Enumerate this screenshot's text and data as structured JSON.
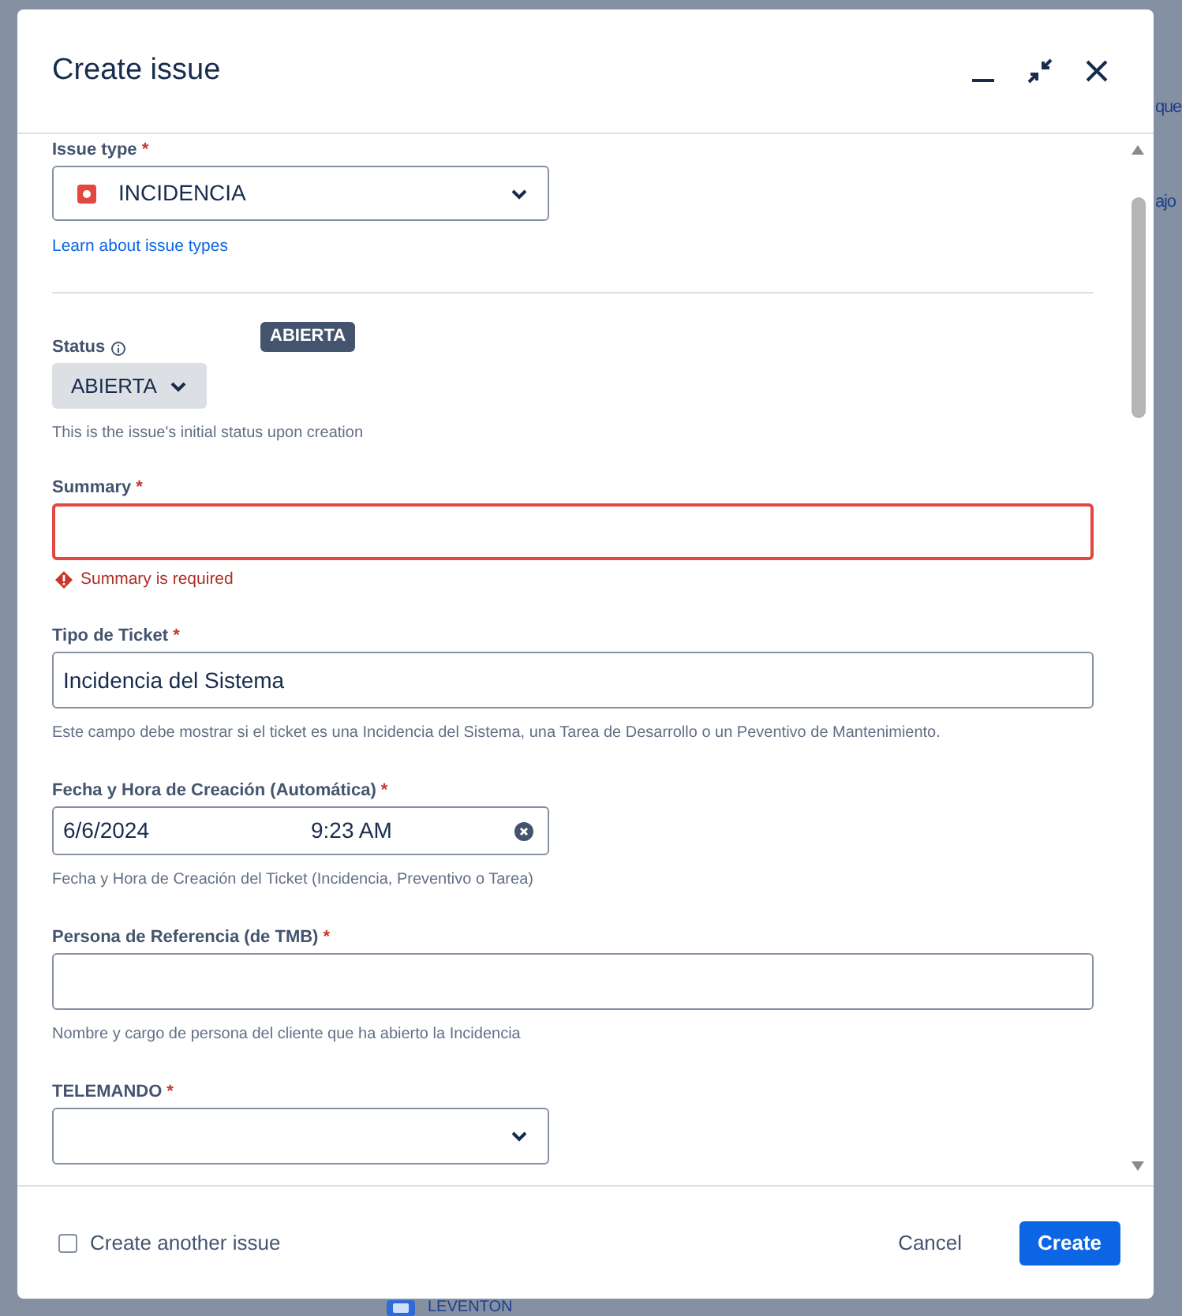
{
  "background": {
    "texts": [
      "que",
      "ajo"
    ],
    "project": "LEVENTON"
  },
  "dialog": {
    "title": "Create issue"
  },
  "fields": [
    {
      "kind": "select",
      "label": "Issue type",
      "required_mark": "*",
      "value": "INCIDENCIA",
      "has_icon": true,
      "link": "Learn about issue types",
      "divider": true
    },
    {
      "kind": "status",
      "label": "Status",
      "tooltip": "ABIERTA",
      "value": "ABIERTA",
      "help": "This is the issue's initial status upon creation"
    },
    {
      "kind": "text",
      "label": "Summary",
      "required_mark": "*",
      "error": "Summary is required"
    },
    {
      "kind": "text",
      "label": "Tipo de Ticket",
      "required_mark": "*",
      "value": "Incidencia del Sistema",
      "help": "Este campo debe mostrar si el ticket es una Incidencia del Sistema, una Tarea de Desarrollo o un Peventivo de Mantenimiento."
    },
    {
      "kind": "datetime",
      "label": "Fecha y Hora de Creación (Automática)",
      "required_mark": "*",
      "date": "6/6/2024",
      "time": "9:23 AM",
      "help": "Fecha y Hora de Creación del Ticket (Incidencia, Preventivo o Tarea)"
    },
    {
      "kind": "text",
      "label": "Persona de Referencia (de TMB)",
      "required_mark": "*",
      "help": "Nombre y cargo de persona del cliente que ha abierto la Incidencia"
    },
    {
      "kind": "select",
      "label": "TELEMANDO",
      "required_mark": "*",
      "has_icon": false
    }
  ],
  "footer": {
    "create_another": {
      "label": "Create another issue",
      "checked": false
    },
    "buttons": [
      {
        "label": "Cancel",
        "kind": "subtle"
      },
      {
        "label": "Create",
        "kind": "primary"
      }
    ]
  }
}
